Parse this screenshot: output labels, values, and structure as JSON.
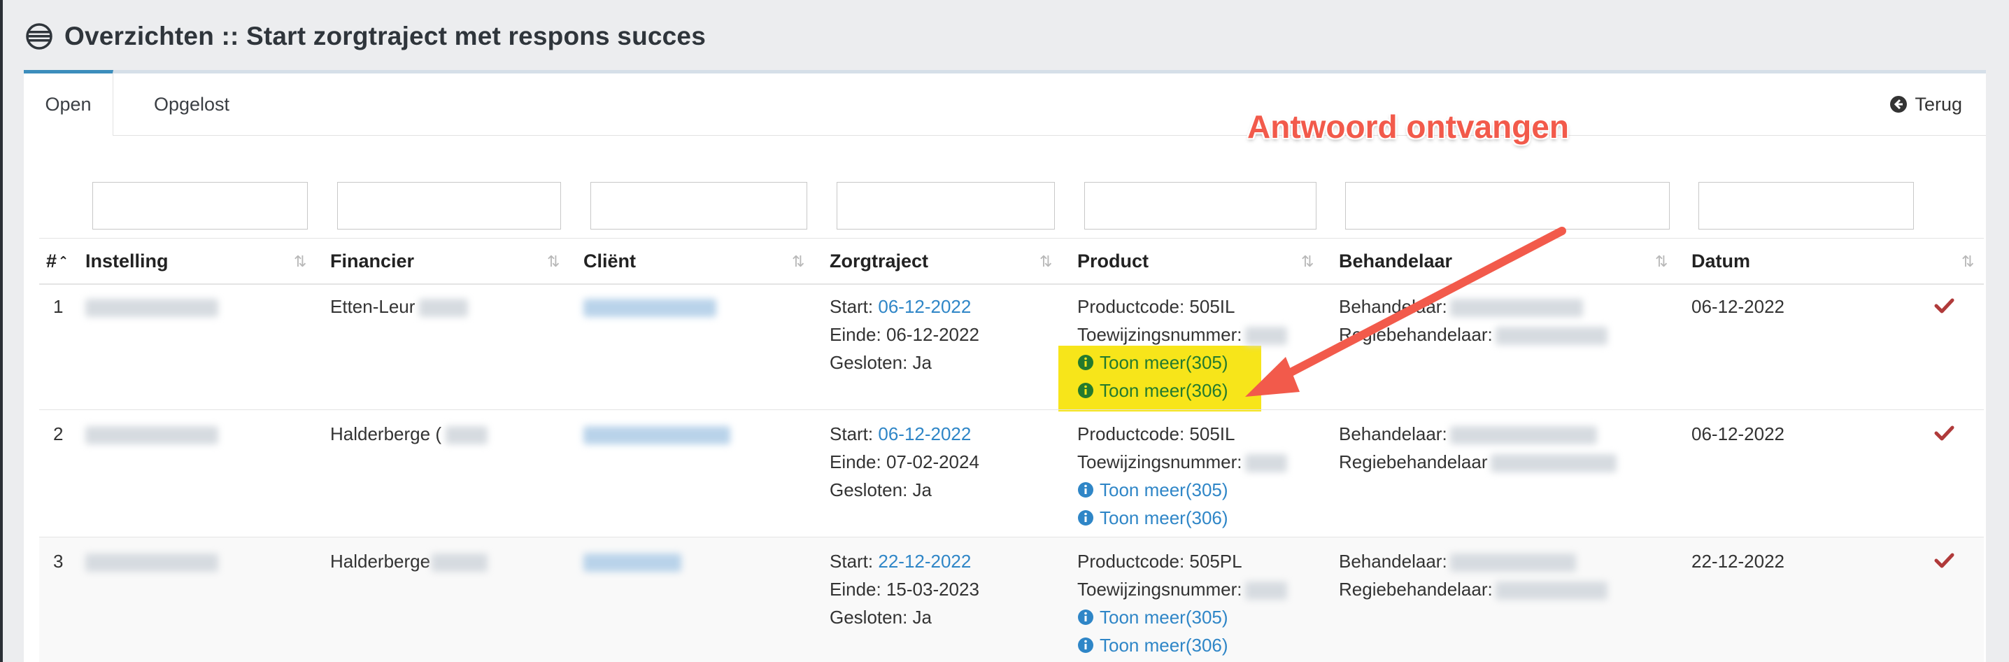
{
  "page": {
    "title": "Overzichten :: Start zorgtraject met respons succes"
  },
  "tabs": {
    "open": "Open",
    "resolved": "Opgelost",
    "back": "Terug"
  },
  "annotation": {
    "text": "Antwoord ontvangen"
  },
  "table": {
    "headers": {
      "num": "#",
      "instelling": "Instelling",
      "financier": "Financier",
      "client": "Cliënt",
      "zorgtraject": "Zorgtraject",
      "product": "Product",
      "behandelaar": "Behandelaar",
      "datum": "Datum"
    },
    "rows": [
      {
        "num": "1",
        "financier": "Etten-Leur",
        "start_label": "Start: ",
        "start_date": "06-12-2022",
        "einde": "Einde: 06-12-2022",
        "gesloten": "Gesloten: Ja",
        "productcode": "Productcode: 505IL",
        "toewijzing": "Toewijzingsnummer:",
        "toon1": "Toon meer(305)",
        "toon2": "Toon meer(306)",
        "behandelaar": "Behandelaar:",
        "regie": "Regiebehandelaar:",
        "datum": "06-12-2022"
      },
      {
        "num": "2",
        "financier": "Halderberge (",
        "start_label": "Start: ",
        "start_date": "06-12-2022",
        "einde": "Einde: 07-02-2024",
        "gesloten": "Gesloten: Ja",
        "productcode": "Productcode: 505IL",
        "toewijzing": "Toewijzingsnummer:",
        "toon1": "Toon meer(305)",
        "toon2": "Toon meer(306)",
        "behandelaar": "Behandelaar:",
        "regie": "Regiebehandelaar",
        "datum": "06-12-2022"
      },
      {
        "num": "3",
        "financier": "Halderberge",
        "start_label": "Start: ",
        "start_date": "22-12-2022",
        "einde": "Einde: 15-03-2023",
        "gesloten": "Gesloten: Ja",
        "productcode": "Productcode: 505PL",
        "toewijzing": "Toewijzingsnummer:",
        "toon1": "Toon meer(305)",
        "toon2": "Toon meer(306)",
        "behandelaar": "Behandelaar:",
        "regie": "Regiebehandelaar:",
        "datum": "22-12-2022"
      }
    ]
  },
  "colors": {
    "accent": "#3c8dbc",
    "link": "#2f86c7",
    "check": "#b03a3a",
    "highlight": "#f7e51a",
    "annotation": "#f25a4b"
  }
}
